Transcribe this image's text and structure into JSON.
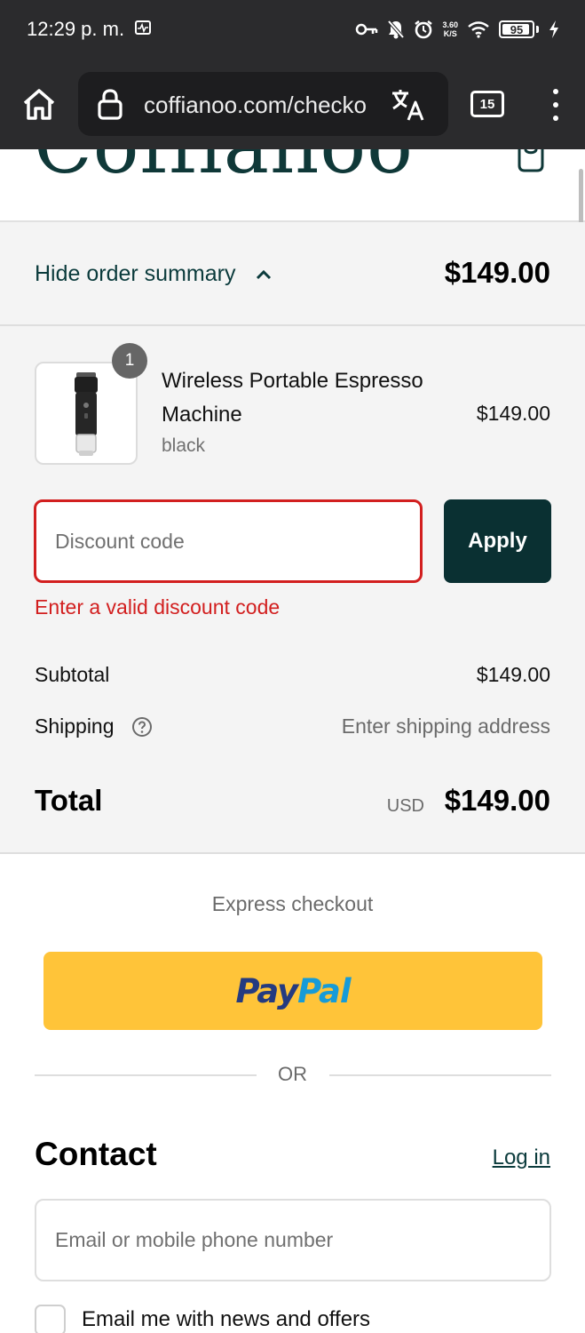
{
  "status_bar": {
    "time": "12:29 p. m.",
    "net_speed_value": "3.60",
    "net_speed_unit": "K/S",
    "battery": "95",
    "battery_level": 0.95,
    "icons": [
      "heart-pulse-icon",
      "key-icon",
      "bell-off-icon",
      "alarm-icon",
      "wifi-icon",
      "battery-icon",
      "charging-icon"
    ]
  },
  "browser": {
    "url": "coffianoo.com/checkout",
    "tab_count": "15",
    "icons": [
      "home-icon",
      "lock-icon",
      "translate-icon",
      "tabs-icon",
      "more-vert-icon"
    ]
  },
  "store": {
    "logo_text": "Coffianoo",
    "brand_color": "#0f3838",
    "icons": [
      "shopping-bag-icon"
    ]
  },
  "order_summary": {
    "toggle_label": "Hide order summary",
    "toggle_total": "$149.00",
    "item": {
      "quantity": "1",
      "name": "Wireless Portable Espresso Machine",
      "variant": "black",
      "price": "$149.00"
    },
    "discount": {
      "placeholder": "Discount code",
      "value": "",
      "apply_label": "Apply",
      "error": "Enter a valid discount code"
    },
    "subtotal_label": "Subtotal",
    "subtotal_value": "$149.00",
    "shipping_label": "Shipping",
    "shipping_value": "Enter shipping address",
    "total_label": "Total",
    "currency": "USD",
    "total_value": "$149.00"
  },
  "express": {
    "title": "Express checkout",
    "paypal_part1": "Pay",
    "paypal_part2": "Pal",
    "or_label": "OR"
  },
  "contact": {
    "title": "Contact",
    "login_label": "Log in",
    "email_placeholder": "Email or mobile phone number",
    "newsletter_label": "Email me with news and offers",
    "newsletter_checked": false
  },
  "colors": {
    "accent": "#0a3032",
    "error": "#d21f1f",
    "paypal_yellow": "#ffc439"
  }
}
